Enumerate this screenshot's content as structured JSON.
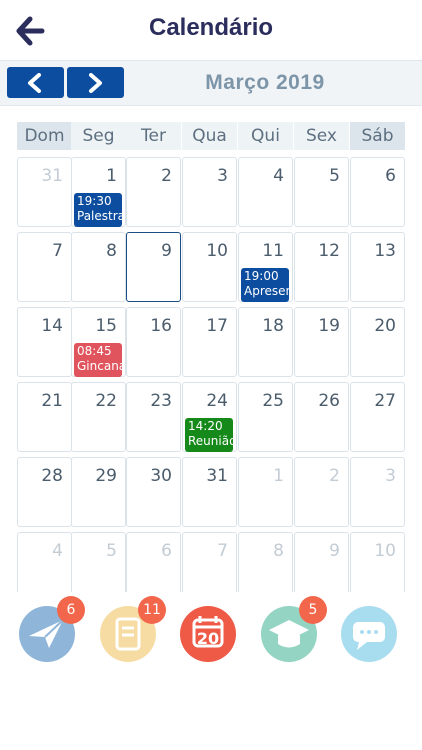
{
  "header": {
    "title": "Calendário",
    "back_icon": "back-arrow-icon"
  },
  "calendar": {
    "month_label": "Março 2019",
    "prev_icon": "chevron-left-icon",
    "next_icon": "chevron-right-icon",
    "weekdays": [
      "Dom",
      "Seg",
      "Ter",
      "Qua",
      "Qui",
      "Sex",
      "Sáb"
    ],
    "weeks": [
      [
        {
          "d": "31",
          "other": true
        },
        {
          "d": "1"
        },
        {
          "d": "2"
        },
        {
          "d": "3"
        },
        {
          "d": "4"
        },
        {
          "d": "5"
        },
        {
          "d": "6"
        }
      ],
      [
        {
          "d": "7"
        },
        {
          "d": "8"
        },
        {
          "d": "9",
          "selected": true
        },
        {
          "d": "10"
        },
        {
          "d": "11"
        },
        {
          "d": "12"
        },
        {
          "d": "13"
        }
      ],
      [
        {
          "d": "14"
        },
        {
          "d": "15"
        },
        {
          "d": "16"
        },
        {
          "d": "17"
        },
        {
          "d": "18"
        },
        {
          "d": "19"
        },
        {
          "d": "20"
        }
      ],
      [
        {
          "d": "21"
        },
        {
          "d": "22"
        },
        {
          "d": "23"
        },
        {
          "d": "24"
        },
        {
          "d": "25"
        },
        {
          "d": "26"
        },
        {
          "d": "27"
        }
      ],
      [
        {
          "d": "28"
        },
        {
          "d": "29"
        },
        {
          "d": "30"
        },
        {
          "d": "31"
        },
        {
          "d": "1",
          "other": true
        },
        {
          "d": "2",
          "other": true
        },
        {
          "d": "3",
          "other": true
        }
      ],
      [
        {
          "d": "4",
          "other": true
        },
        {
          "d": "5",
          "other": true
        },
        {
          "d": "6",
          "other": true
        },
        {
          "d": "7",
          "other": true
        },
        {
          "d": "8",
          "other": true
        },
        {
          "d": "9",
          "other": true
        },
        {
          "d": "10",
          "other": true
        }
      ]
    ],
    "events": [
      {
        "week": 0,
        "day": 1,
        "time": "19:30",
        "title": "Palestra",
        "color": "#0d4d9f"
      },
      {
        "week": 1,
        "day": 4,
        "time": "19:00",
        "title": "Apresen",
        "color": "#0d4d9f"
      },
      {
        "week": 2,
        "day": 1,
        "time": "08:45",
        "title": "Gincana",
        "color": "#e0545e"
      },
      {
        "week": 3,
        "day": 3,
        "time": "14:20",
        "title": "Reunião",
        "color": "#158a1a"
      }
    ]
  },
  "tabbar": {
    "items": [
      {
        "name": "messages",
        "icon": "paper-plane-icon",
        "badge": "6",
        "color": "#8fb6d9"
      },
      {
        "name": "notebook",
        "icon": "notebook-icon",
        "badge": "11",
        "color": "#f6dca3"
      },
      {
        "name": "calendar",
        "icon": "calendar-icon",
        "badge": "",
        "label": "20",
        "color": "#ee5a45"
      },
      {
        "name": "education",
        "icon": "graduation-cap-icon",
        "badge": "5",
        "color": "#93d4c2"
      },
      {
        "name": "chat",
        "icon": "chat-bubble-icon",
        "badge": "",
        "color": "#a8dcef"
      }
    ]
  }
}
